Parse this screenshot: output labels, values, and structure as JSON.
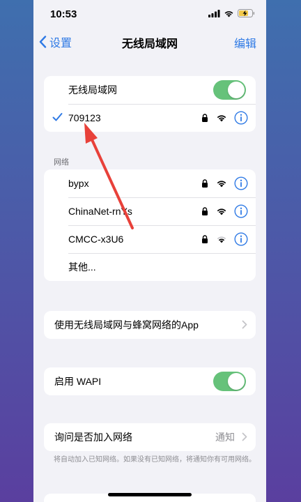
{
  "status_bar": {
    "time": "10:53"
  },
  "nav": {
    "back_label": "设置",
    "title": "无线局域网",
    "edit_label": "编辑"
  },
  "wlan": {
    "toggle_label": "无线局域网",
    "toggle_on": true,
    "connected_network": "709123"
  },
  "networks": {
    "header": "网络",
    "items": [
      {
        "name": "bypx"
      },
      {
        "name": "ChinaNet-rnYs"
      },
      {
        "name": "CMCC-x3U6"
      }
    ],
    "other_label": "其他..."
  },
  "app_access": {
    "label": "使用无线局域网与蜂窝网络的App"
  },
  "wapi": {
    "label": "启用 WAPI",
    "toggle_on": true
  },
  "ask_join": {
    "label": "询问是否加入网络",
    "value": "通知",
    "footnote": "将自动加入已知网络。如果没有已知网络，将通知你有可用网络。"
  },
  "colors": {
    "accent": "#2f7ae5",
    "toggle_on": "#66c27a",
    "annotation_arrow": "#e8413a",
    "background": "#f2f2f7"
  }
}
